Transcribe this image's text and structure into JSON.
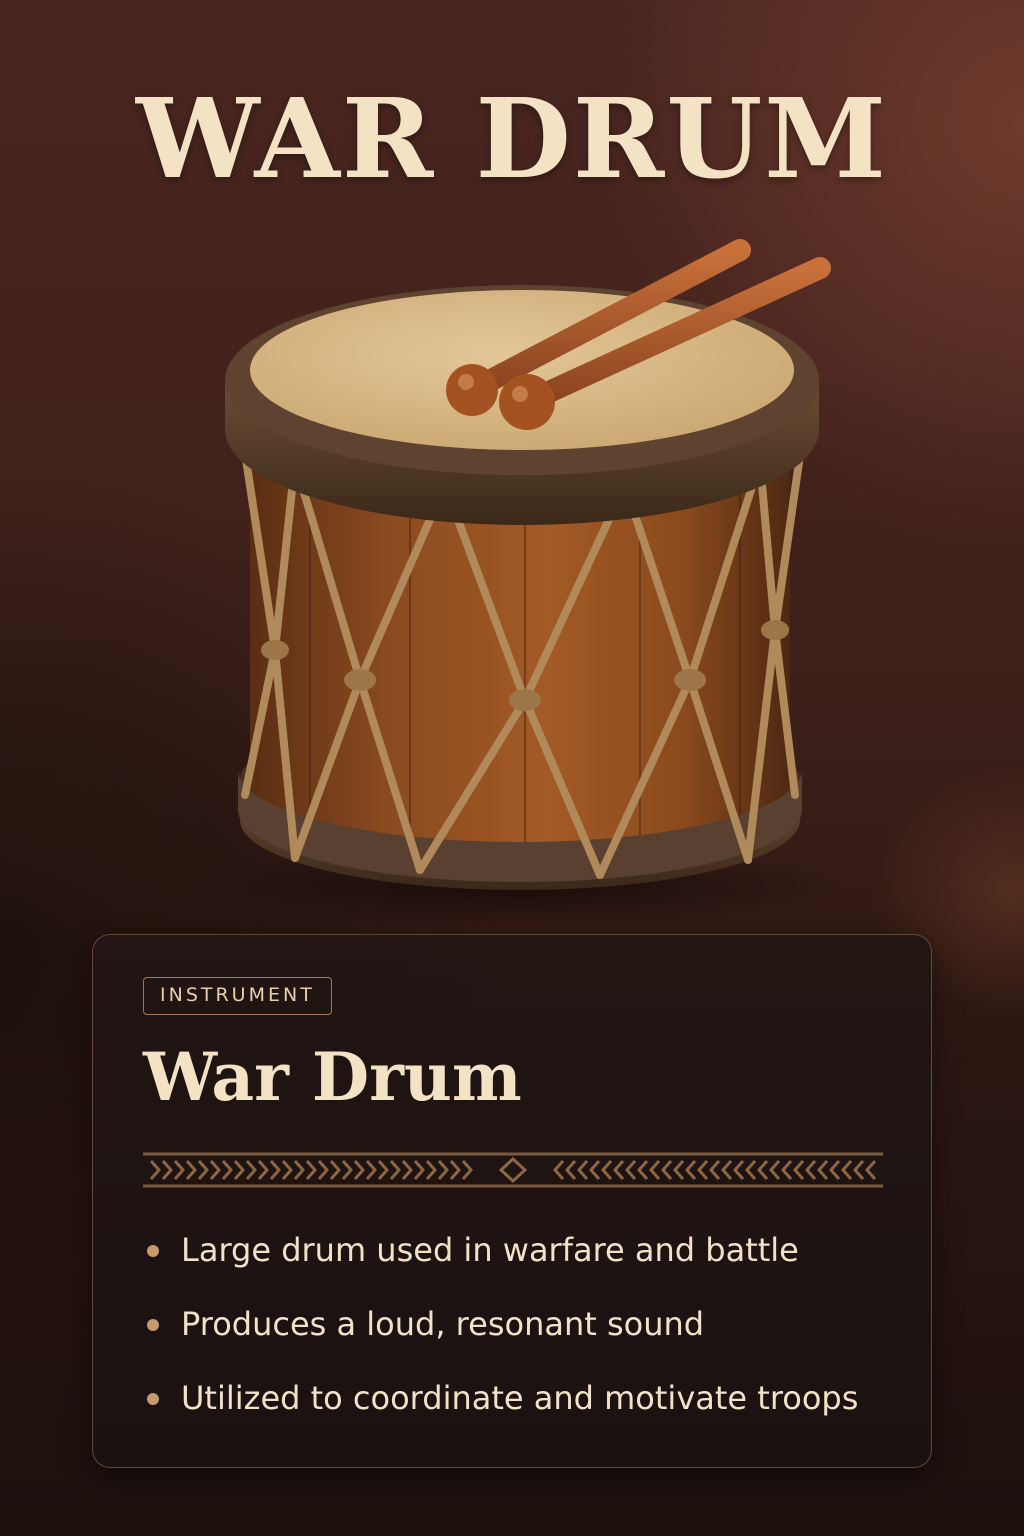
{
  "page": {
    "title": "WAR DRUM"
  },
  "illustration": {
    "icon": "war-drum-illustration",
    "colors": {
      "drumhead": "#d9b98a",
      "rim": "#5a3f2b",
      "shell": "#8a4e22",
      "rope": "#b08a5a",
      "drumstick": "#a8572a"
    }
  },
  "card": {
    "category": "INSTRUMENT",
    "title": "War Drum",
    "features": [
      "Large drum used in warfare and battle",
      "Produces a loud, resonant sound",
      "Utilized to coordinate and motivate troops"
    ]
  },
  "theme": {
    "background": "#3d1f1a",
    "title_color": "#f4e2c4",
    "accent": "#c69a6c",
    "card_background": "#221614"
  }
}
